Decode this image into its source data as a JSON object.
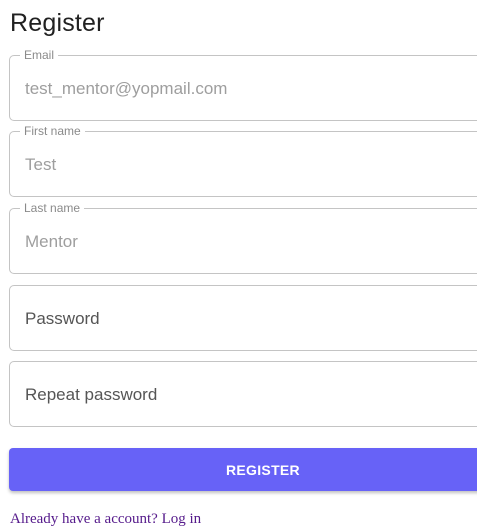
{
  "page": {
    "title": "Register"
  },
  "form": {
    "email": {
      "label": "Email",
      "value": "test_mentor@yopmail.com"
    },
    "first_name": {
      "label": "First name",
      "value": "Test"
    },
    "last_name": {
      "label": "Last name",
      "value": "Mentor"
    },
    "password": {
      "placeholder": "Password"
    },
    "repeat_password": {
      "placeholder": "Repeat password"
    },
    "submit_label": "REGISTER"
  },
  "footer": {
    "prompt": "Already have a account?",
    "login_link": "Log in"
  },
  "colors": {
    "accent": "#6762f7",
    "link": "#551a8b",
    "border": "#c4c4c4"
  }
}
